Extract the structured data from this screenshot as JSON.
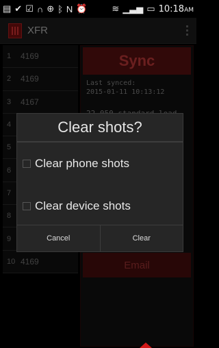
{
  "status_bar": {
    "icons": [
      "notification-icon",
      "check-circle-icon",
      "clipboard-icon",
      "headset-icon",
      "gps-icon",
      "bluetooth-icon",
      "nfc-icon",
      "alarm-icon",
      "wifi-icon",
      "signal-icon",
      "battery-icon"
    ],
    "time": "10:18",
    "ampm": "AM"
  },
  "action_bar": {
    "title": "XFR"
  },
  "list": {
    "rows": [
      {
        "index": "1",
        "value": "4169"
      },
      {
        "index": "2",
        "value": "4169"
      },
      {
        "index": "3",
        "value": "4167"
      },
      {
        "index": "4",
        "value": ""
      },
      {
        "index": "5",
        "value": ""
      },
      {
        "index": "6",
        "value": ""
      },
      {
        "index": "7",
        "value": ""
      },
      {
        "index": "8",
        "value": ""
      },
      {
        "index": "9",
        "value": ""
      },
      {
        "index": "10",
        "value": "4169"
      }
    ]
  },
  "panel": {
    "sync_label": "Sync",
    "last_synced_label": "Last synced:",
    "last_synced_value": "2015-01-11 10:13:12",
    "loaded_text": "22,050 standard load",
    "email_label": "Email"
  },
  "dialog": {
    "title": "Clear shots?",
    "option_phone": "Clear phone shots",
    "option_device": "Clear device shots",
    "cancel_label": "Cancel",
    "clear_label": "Clear"
  },
  "colors": {
    "accent": "#5a1111",
    "accent_text": "#c23a3a",
    "indicator": "#d01818"
  }
}
